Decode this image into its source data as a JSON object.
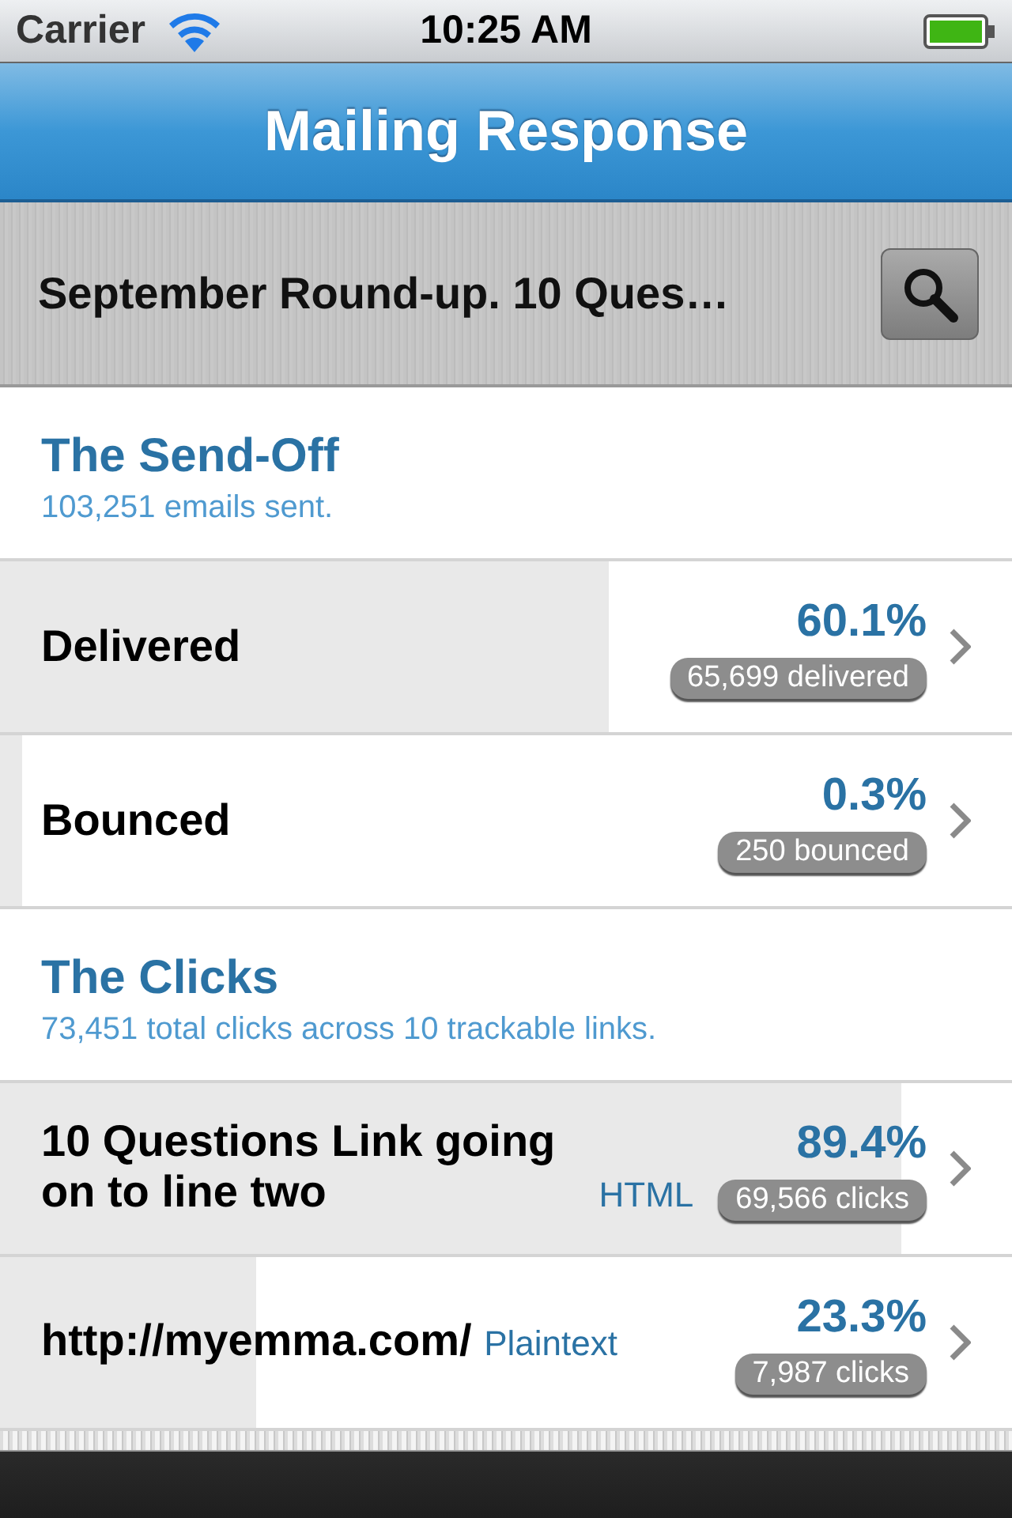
{
  "status_bar": {
    "carrier": "Carrier",
    "time": "10:25 AM"
  },
  "nav_bar": {
    "title": "Mailing Response"
  },
  "mailing": {
    "subject": "September Round-up. 10 Ques…"
  },
  "sections": [
    {
      "title": "The Send-Off",
      "subtitle": "103,251 emails sent.",
      "rows": [
        {
          "label": "Delivered",
          "percent": "60.1%",
          "count": "65,699 delivered",
          "level": 0.601
        },
        {
          "label": "Bounced",
          "percent": "0.3%",
          "count": "250 bounced",
          "level": 0.022
        }
      ]
    },
    {
      "title": "The Clicks",
      "subtitle": "73,451 total clicks across 10 trackable links.",
      "rows": [
        {
          "label": "10 Questions Link going on to line two",
          "tag": "HTML",
          "percent": "89.4%",
          "count": "69,566 clicks",
          "level": 0.89
        },
        {
          "label": "http://myemma.com/",
          "tag": "Plaintext",
          "percent": "23.3%",
          "count": "7,987 clicks",
          "level": 0.253
        }
      ]
    }
  ]
}
